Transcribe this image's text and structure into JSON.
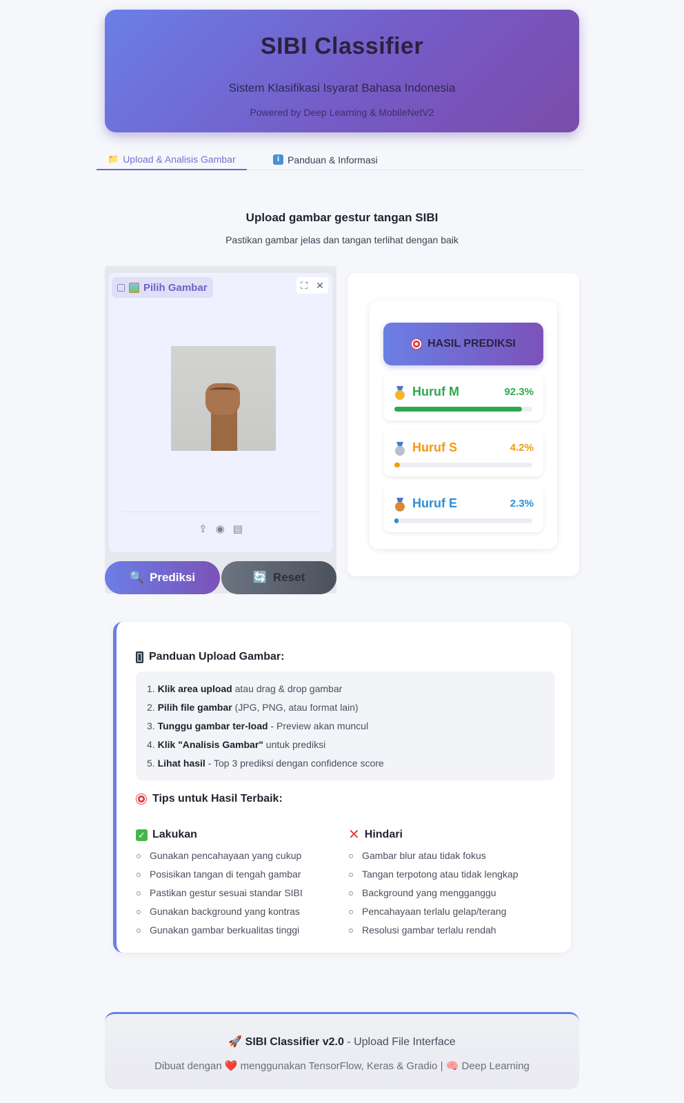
{
  "header": {
    "title": "SIBI Classifier",
    "subtitle": "Sistem Klasifikasi Isyarat Bahasa Indonesia",
    "powered": "Powered by Deep Learning & MobileNetV2"
  },
  "tabs": [
    {
      "label": "Upload & Analisis Gambar",
      "icon": "folder-icon",
      "active": true
    },
    {
      "label": "Panduan & Informasi",
      "icon": "info-icon",
      "active": false
    }
  ],
  "upload": {
    "title": "Upload gambar gestur tangan SIBI",
    "description": "Pastikan gambar jelas dan tangan terlihat dengan baik",
    "dropzone_label": "Pilih Gambar",
    "tools": {
      "fullscreen": "⛶",
      "close": "✕"
    },
    "source_icons": {
      "upload": "⇪",
      "webcam": "◉",
      "clipboard": "▤"
    }
  },
  "buttons": {
    "predict": "Prediksi",
    "predict_icon": "🔍",
    "reset": "Reset",
    "reset_icon": "🔄"
  },
  "results": {
    "title": "HASIL PREDIKSI",
    "predictions": [
      {
        "label": "Huruf M",
        "percent": "92.3%",
        "fraction": 0.923,
        "color": "#2fa84f",
        "medal": "gold"
      },
      {
        "label": "Huruf S",
        "percent": "4.2%",
        "fraction": 0.042,
        "color": "#f29a0e",
        "medal": "silver"
      },
      {
        "label": "Huruf E",
        "percent": "2.3%",
        "fraction": 0.023,
        "color": "#2a8fd6",
        "medal": "bronze"
      }
    ]
  },
  "guide": {
    "title": "Panduan Upload Gambar:",
    "steps": [
      {
        "num": "1.",
        "bold": "Klik area upload",
        "rest": " atau drag & drop gambar"
      },
      {
        "num": "2.",
        "bold": "Pilih file gambar",
        "rest": " (JPG, PNG, atau format lain)"
      },
      {
        "num": "3.",
        "bold": "Tunggu gambar ter-load",
        "rest": " - Preview akan muncul"
      },
      {
        "num": "4.",
        "bold": "Klik \"Analisis Gambar\"",
        "rest": " untuk prediksi"
      },
      {
        "num": "5.",
        "bold": "Lihat hasil",
        "rest": " - Top 3 prediksi dengan confidence score"
      }
    ],
    "tips_title": "Tips untuk Hasil Terbaik:",
    "do": {
      "title": "Lakukan",
      "items": [
        "Gunakan pencahayaan yang cukup",
        "Posisikan tangan di tengah gambar",
        "Pastikan gestur sesuai standar SIBI",
        "Gunakan background yang kontras",
        "Gunakan gambar berkualitas tinggi"
      ]
    },
    "dont": {
      "title": "Hindari",
      "items": [
        "Gambar blur atau tidak fokus",
        "Tangan terpotong atau tidak lengkap",
        "Background yang mengganggu",
        "Pencahayaan terlalu gelap/terang",
        "Resolusi gambar terlalu rendah"
      ]
    }
  },
  "footer": {
    "icon": "🚀",
    "product": "SIBI Classifier v2.0",
    "tagline": " - Upload File Interface",
    "made_prefix": "Dibuat dengan ",
    "heart": "❤️",
    "made_suffix": " menggunakan TensorFlow, Keras & Gradio | ",
    "brain": "🧠",
    "made_end": " Deep Learning"
  },
  "colors": {
    "accent": "#6b7fe0",
    "accent_purple": "#7b52b8"
  }
}
